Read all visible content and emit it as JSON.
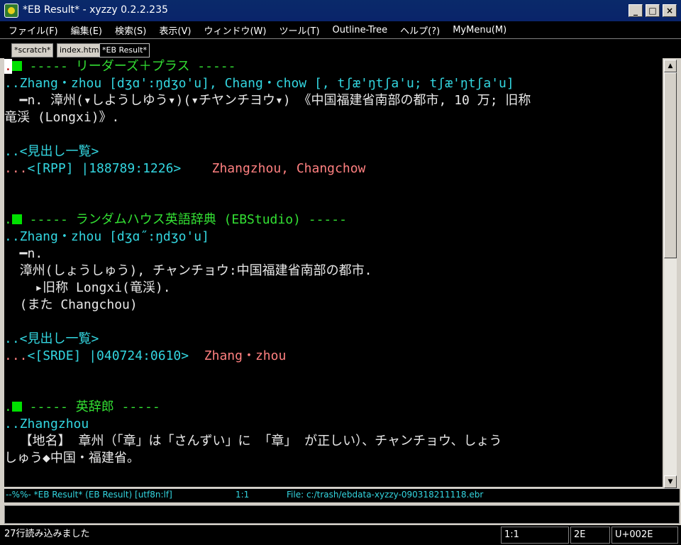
{
  "window": {
    "title": "*EB Result* - xyzzy 0.2.2.235"
  },
  "menu": [
    "ファイル(F)",
    "編集(E)",
    "検索(S)",
    "表示(V)",
    "ウィンドウ(W)",
    "ツール(T)",
    "Outline-Tree",
    "ヘルプ(?)",
    "MyMenu(M)"
  ],
  "tabs": [
    {
      "label": "*scratch*"
    },
    {
      "label": "index.html"
    },
    {
      "label": "*EB Result*"
    }
  ],
  "buffer": {
    "l1": {
      "cursor": ".",
      "text": " ----- リーダーズ＋プラス -----"
    },
    "l2": "..Zhang・zhou [dʒɑ':ŋdʒo'u], Chang・chow [, tʃæ'ŋtʃa'u; tʃæ'ŋtʃa'u]",
    "l3": "  ━n. 漳州(▾しようしゆう▾)(▾チヤンチヨウ▾) 《中国福建省南部の都市, 10 万; 旧称",
    "l4": "竜渓 (Longxi)》.",
    "l5": "..<見出し一覧>",
    "l6": {
      "dots": "...",
      "ref": "<[RPP] |188789:1226>",
      "head": "Zhangzhou, Changchow"
    },
    "l7": {
      "dot": ".",
      "text": " ----- ランダムハウス英語辞典 (EBStudio) -----"
    },
    "l8": "..Zhang・zhou [dʒɑ˝:ŋdʒo'u]",
    "l9": "  ━n.",
    "l10": "  漳州(しょうしゅう), チャンチョウ:中国福建省南部の都市.",
    "l11": "    ▸旧称 Longxi(竜渓).",
    "l12": "  (また Changchou)",
    "l13": "..<見出し一覧>",
    "l14": {
      "dots": "...",
      "ref": "<[SRDE] |040724:0610>",
      "head": "Zhang・zhou"
    },
    "l15": {
      "dot": ".",
      "text": " ----- 英辞郎 -----"
    },
    "l16": "..Zhangzhou",
    "l17": "  【地名】 章州（「章」は「さんずい」に 「章」 が正しい）、チャンチョウ、しょう",
    "l18": "しゅう◆中国・福建省。"
  },
  "modeline": {
    "left": "--%%- *EB Result* (EB Result) [utf8n:lf]",
    "pos": "1:1",
    "file": "File: c:/trash/ebdata-xyzzy-090318211118.ebr"
  },
  "status": {
    "message": "27行読み込みました",
    "linecol": "1:1",
    "hex": "2E",
    "unicode": "U+002E"
  },
  "colors": {
    "cyan": "#33d6e0",
    "green": "#33e033",
    "pink": "#ff8080",
    "background": "#000000"
  }
}
